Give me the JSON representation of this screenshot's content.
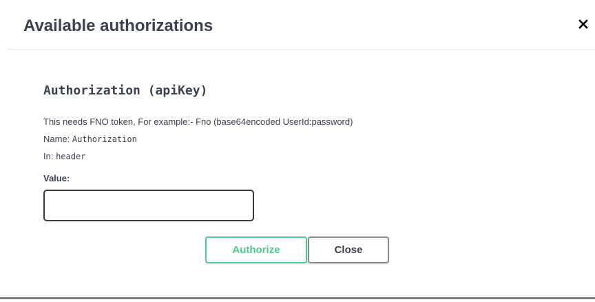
{
  "modal": {
    "title": "Available authorizations",
    "close_icon": "close-x-icon"
  },
  "auth": {
    "scheme_title": "Authorization  (apiKey)",
    "description": "This needs FNO token, For example:- Fno (base64encoded UserId:password)",
    "name_label": "Name: ",
    "name_value": "Authorization",
    "in_label": "In: ",
    "in_value": "header",
    "value_label": "Value:",
    "value_input": "",
    "value_placeholder": ""
  },
  "buttons": {
    "authorize": "Authorize",
    "close": "Close"
  },
  "colors": {
    "authorize_accent": "#49cc90",
    "text": "#3b4151"
  }
}
